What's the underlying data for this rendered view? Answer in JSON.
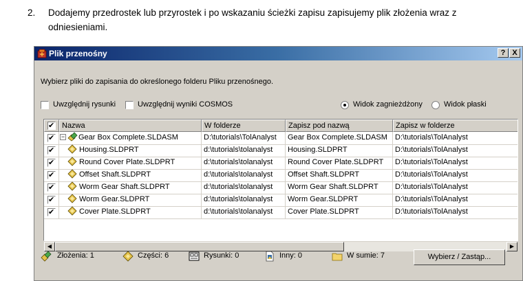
{
  "instruction": {
    "number": "2.",
    "text": "Dodajemy przedrostek lub przyrostek i po wskazaniu  ścieżki zapisu zapisujemy plik złożenia wraz z odniesieniami."
  },
  "dialog": {
    "title": "Plik przenośny",
    "help_label": "?",
    "close_label": "X",
    "prompt": "Wybierz pliki do zapisania do określonego folderu Pliku przenośnego.",
    "options": {
      "include_drawings": "Uwzględnij rysunki",
      "include_cosmos": "Uwzględnij wyniki COSMOS",
      "nested_view": "Widok zagnieżdżony",
      "flat_view": "Widok płaski"
    },
    "columns": {
      "name": "Nazwa",
      "in_folder": "W folderze",
      "save_as": "Zapisz pod nazwą",
      "save_in_folder": "Zapisz w folderze"
    },
    "rows": [
      {
        "name": "Gear Box Complete.SLDASM",
        "in_folder": "D:\\tutorials\\TolAnalyst",
        "save_as": "Gear Box Complete.SLDASM",
        "save_in_folder": "D:\\tutorials\\TolAnalyst"
      },
      {
        "name": "Housing.SLDPRT",
        "in_folder": "d:\\tutorials\\tolanalyst",
        "save_as": "Housing.SLDPRT",
        "save_in_folder": "D:\\tutorials\\TolAnalyst"
      },
      {
        "name": "Round Cover Plate.SLDPRT",
        "in_folder": "d:\\tutorials\\tolanalyst",
        "save_as": "Round Cover Plate.SLDPRT",
        "save_in_folder": "D:\\tutorials\\TolAnalyst"
      },
      {
        "name": "Offset Shaft.SLDPRT",
        "in_folder": "d:\\tutorials\\tolanalyst",
        "save_as": "Offset Shaft.SLDPRT",
        "save_in_folder": "D:\\tutorials\\TolAnalyst"
      },
      {
        "name": "Worm Gear Shaft.SLDPRT",
        "in_folder": "d:\\tutorials\\tolanalyst",
        "save_as": "Worm Gear Shaft.SLDPRT",
        "save_in_folder": "D:\\tutorials\\TolAnalyst"
      },
      {
        "name": "Worm Gear.SLDPRT",
        "in_folder": "d:\\tutorials\\tolanalyst",
        "save_as": "Worm Gear.SLDPRT",
        "save_in_folder": "D:\\tutorials\\TolAnalyst"
      },
      {
        "name": "Cover Plate.SLDPRT",
        "in_folder": "d:\\tutorials\\tolanalyst",
        "save_as": "Cover Plate.SLDPRT",
        "save_in_folder": "D:\\tutorials\\TolAnalyst"
      }
    ],
    "status": {
      "assemblies": "Złożenia: 1",
      "parts": "Części: 6",
      "drawings": "Rysunki: 0",
      "other": "Inny: 0",
      "total": "W sumie: 7"
    },
    "button_label": "Wybierz / Zastąp..."
  }
}
